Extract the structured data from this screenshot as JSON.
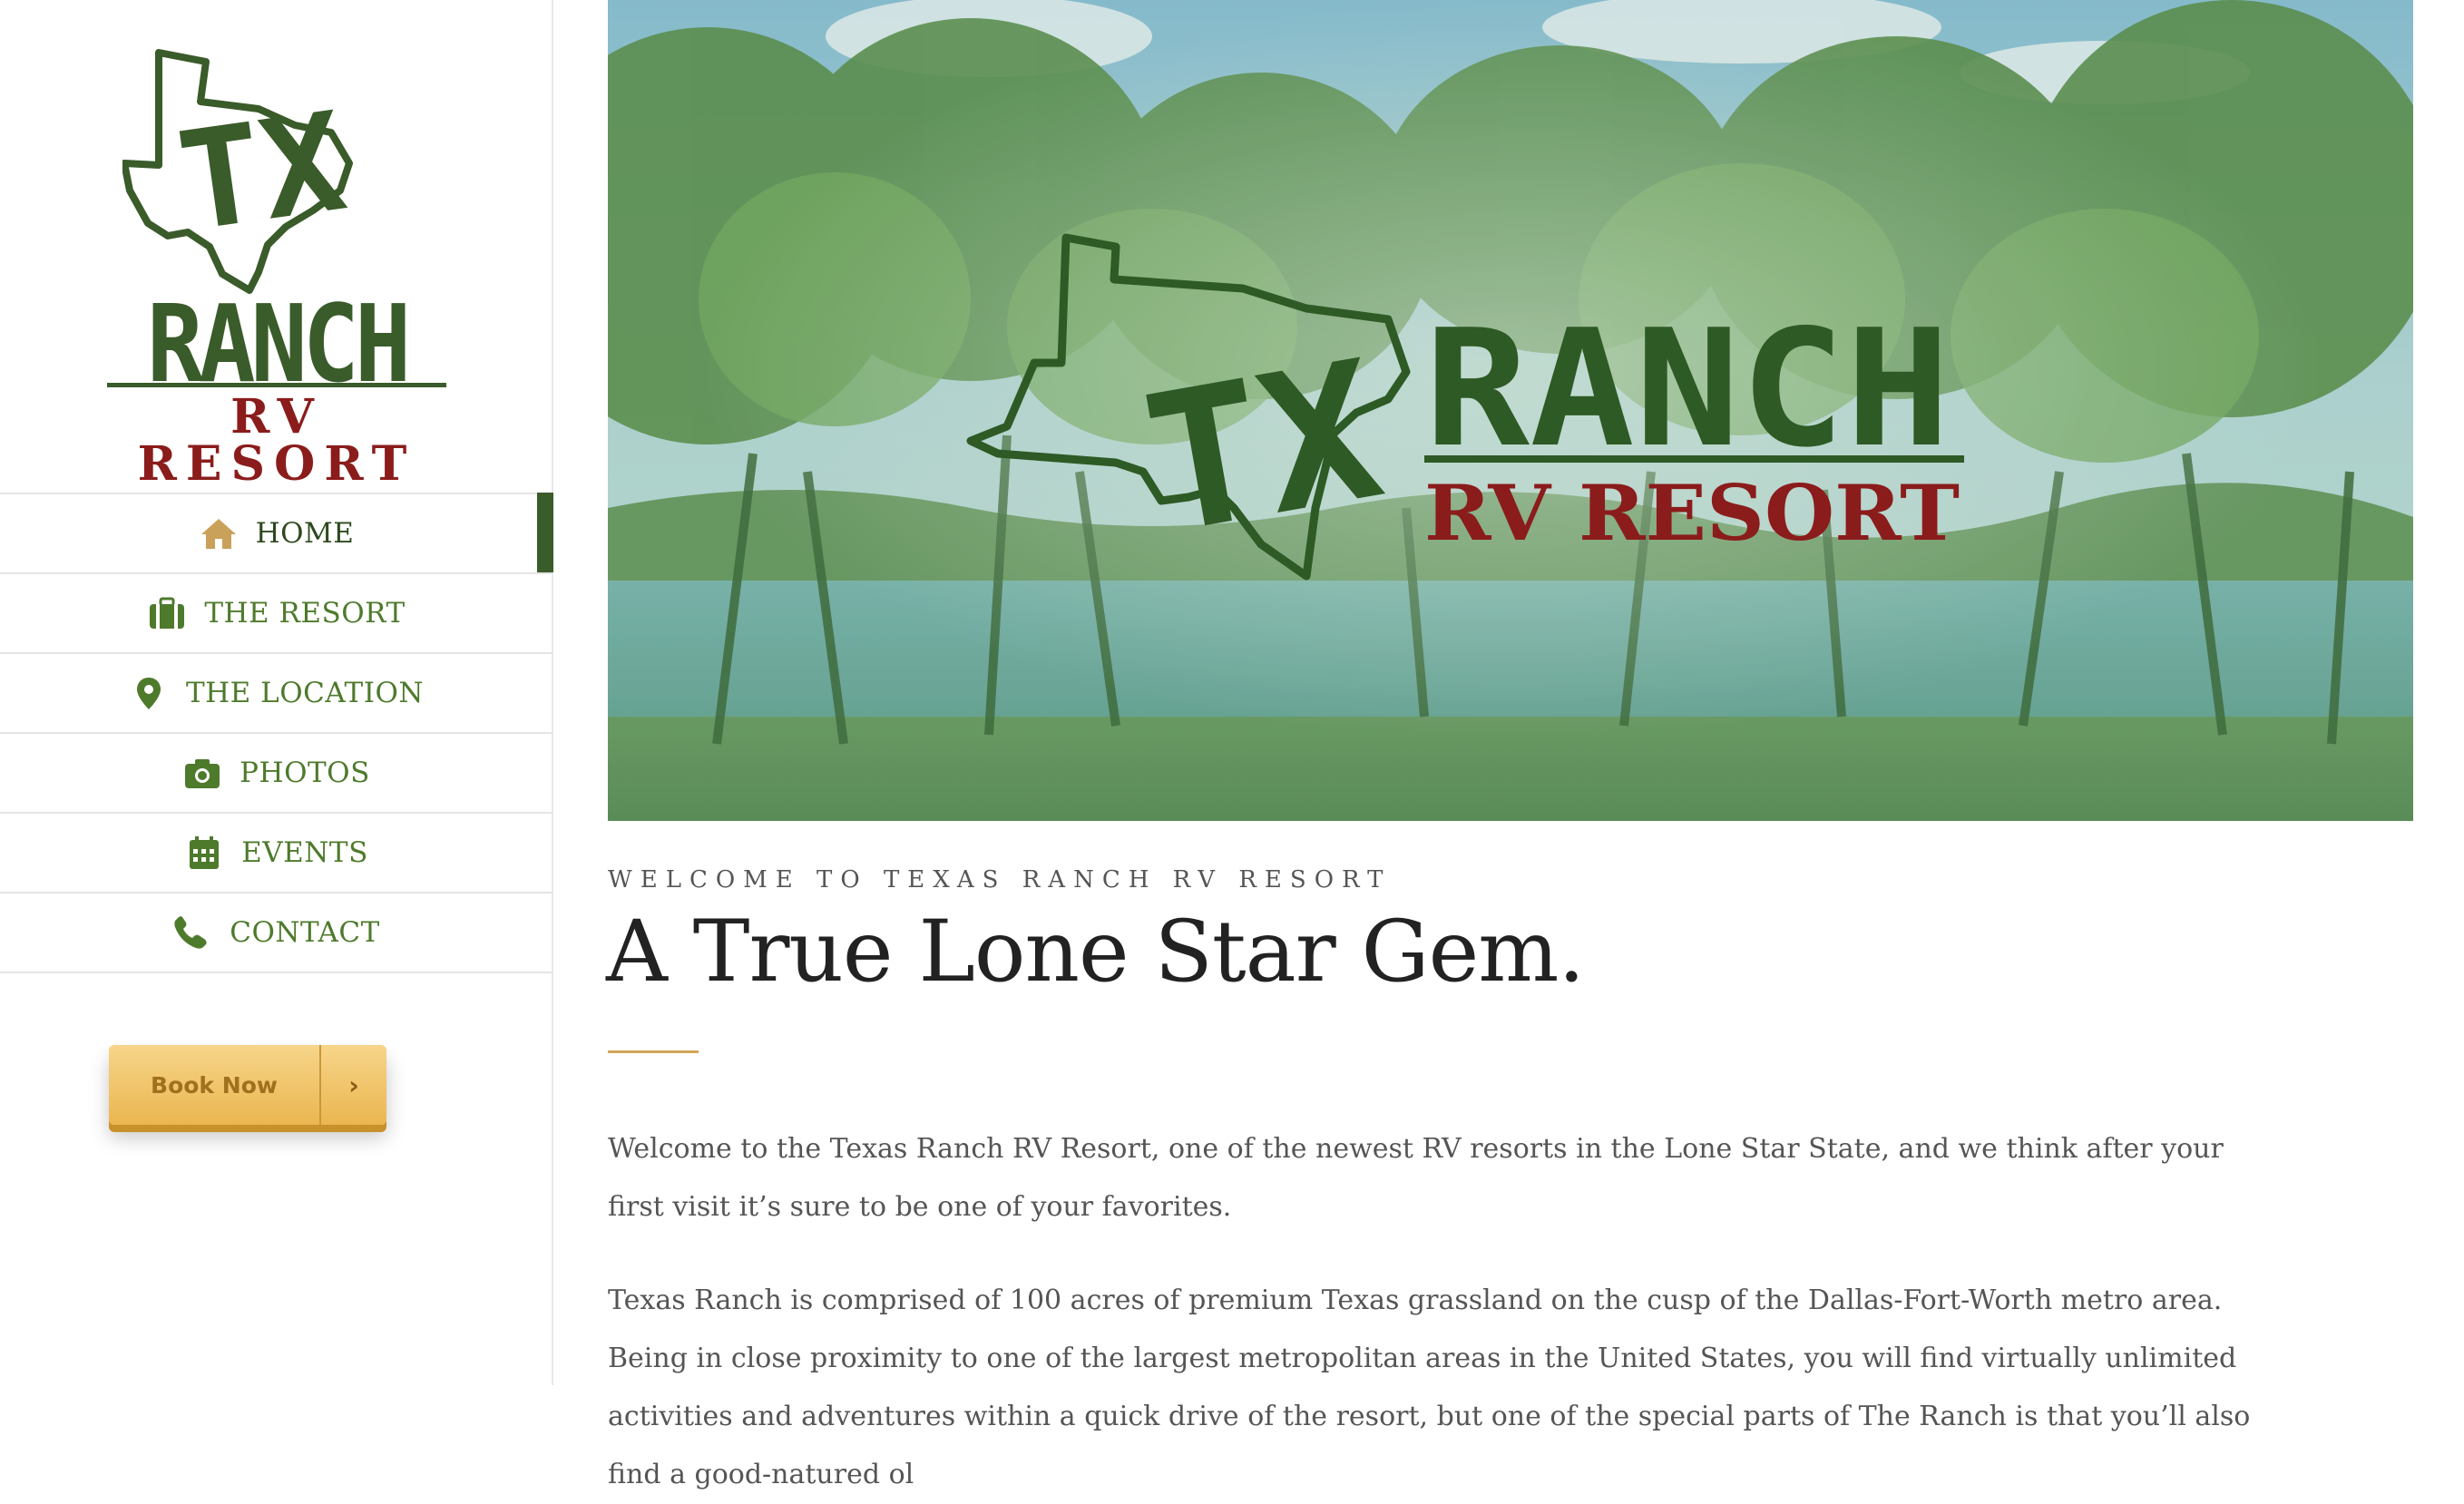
{
  "brand": {
    "logo_text_main": "RANCH",
    "logo_text_sub": "RV RESORT",
    "logo_text_tx": "TX",
    "colors": {
      "green": "#3a5b2a",
      "red": "#8b1c1c",
      "nav_green": "#4e7a2c",
      "gold": "#eab650"
    }
  },
  "nav": {
    "items": [
      {
        "label": "HOME",
        "icon": "home-icon",
        "active": true
      },
      {
        "label": "THE RESORT",
        "icon": "briefcase-icon",
        "active": false
      },
      {
        "label": "THE LOCATION",
        "icon": "map-marker-icon",
        "active": false
      },
      {
        "label": "PHOTOS",
        "icon": "camera-icon",
        "active": false
      },
      {
        "label": "EVENTS",
        "icon": "calendar-icon",
        "active": false
      },
      {
        "label": "CONTACT",
        "icon": "phone-icon",
        "active": false
      }
    ]
  },
  "book": {
    "label": "Book Now",
    "arrow": "›"
  },
  "hero": {
    "logo_text_main": "RANCH",
    "logo_text_sub": "RV RESORT",
    "logo_text_tx": "TX"
  },
  "main": {
    "eyebrow": "WELCOME TO TEXAS RANCH RV RESORT",
    "title": "A True Lone Star Gem.",
    "paragraphs": [
      "Welcome to the Texas Ranch RV Resort, one of the newest RV resorts in the Lone Star State, and we think after your first visit it’s sure to be one of your favorites.",
      "Texas Ranch is comprised of 100 acres of premium Texas grassland on the cusp of the Dallas-Fort-Worth metro area. Being in close proximity to one of the largest metropolitan areas in the United States, you will find virtually unlimited activities and adventures within a quick drive of the resort, but one of the special parts of The Ranch is that you’ll also find a good-natured ol"
    ]
  }
}
